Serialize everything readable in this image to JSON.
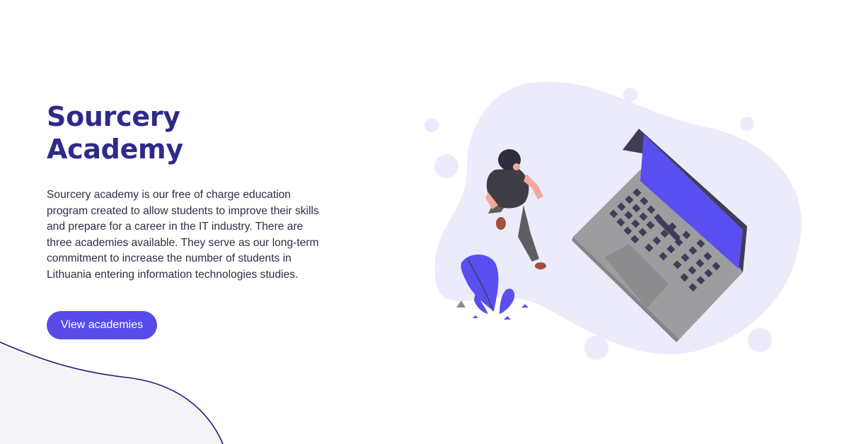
{
  "hero": {
    "title_line1": "Sourcery",
    "title_line2": "Academy",
    "description": "Sourcery academy is our free of charge education program created to allow students to improve their skills and prepare for a career in the IT industry. There are three academies available. They serve as our long-term commitment to increase the number of students in Lithuania entering information technologies studies.",
    "cta_label": "View academies"
  },
  "colors": {
    "title": "#2e2a8a",
    "accent": "#574be9",
    "blob": "#ecebfb",
    "laptop_body": "#9d9d9f",
    "laptop_screen": "#5b4ef0"
  },
  "icons": [
    "person-illustration",
    "laptop-illustration",
    "plant-illustration"
  ]
}
